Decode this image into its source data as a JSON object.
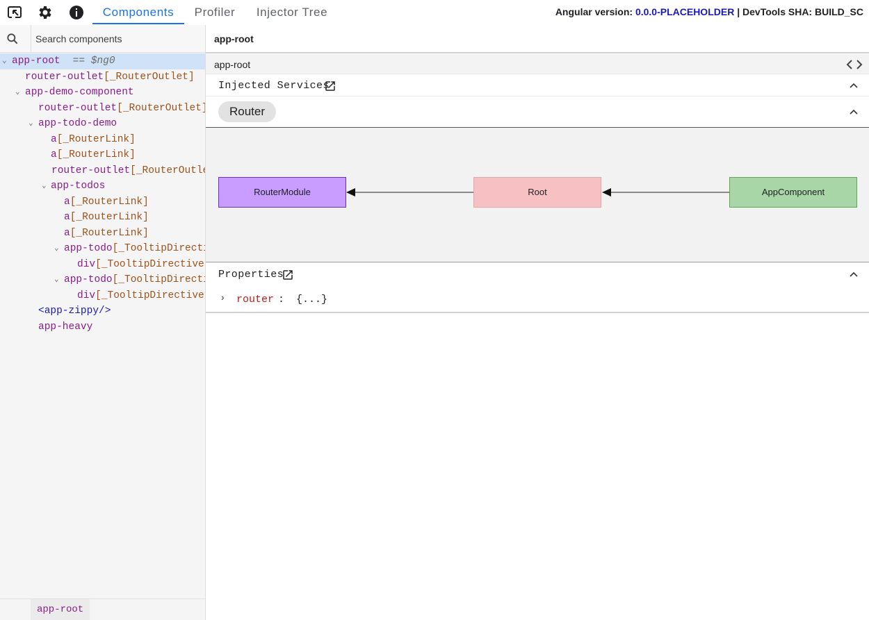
{
  "toolbar": {
    "icons": [
      "inspect-element-icon",
      "gear-icon",
      "info-icon"
    ],
    "tabs": [
      {
        "label": "Components",
        "active": true
      },
      {
        "label": "Profiler",
        "active": false
      },
      {
        "label": "Injector Tree",
        "active": false
      }
    ],
    "version_label": "Angular version:",
    "version_value": "0.0.0-PLACEHOLDER",
    "sha_text": "| DevTools SHA: BUILD_SC"
  },
  "search": {
    "placeholder": "Search components",
    "value": ""
  },
  "tree": {
    "nodes": [
      {
        "name": "app-root",
        "dir": "",
        "ng0": "== $ng0",
        "expanded": true,
        "selected": true
      },
      {
        "name": "router-outlet",
        "dir": "[_RouterOutlet]"
      },
      {
        "name": "app-demo-component",
        "dir": "",
        "expanded": true
      },
      {
        "name": "router-outlet",
        "dir": "[_RouterOutlet]"
      },
      {
        "name": "app-todo-demo",
        "dir": "",
        "expanded": true
      },
      {
        "name": "a",
        "dir": "[_RouterLink]"
      },
      {
        "name": "a",
        "dir": "[_RouterLink]"
      },
      {
        "name": "router-outlet",
        "dir": "[_RouterOutlet]"
      },
      {
        "name": "app-todos",
        "dir": "",
        "expanded": true
      },
      {
        "name": "a",
        "dir": "[_RouterLink]"
      },
      {
        "name": "a",
        "dir": "[_RouterLink]"
      },
      {
        "name": "a",
        "dir": "[_RouterLink]"
      },
      {
        "name": "app-todo",
        "dir": "[_TooltipDirective]",
        "expanded": true
      },
      {
        "name": "div",
        "dir": "[_TooltipDirective]"
      },
      {
        "name": "app-todo",
        "dir": "[_TooltipDirective]",
        "expanded": true
      },
      {
        "name": "div",
        "dir": "[_TooltipDirective]"
      },
      {
        "name": "<app-zippy/>",
        "dir": "",
        "zippy": true
      },
      {
        "name": "app-heavy",
        "dir": ""
      }
    ]
  },
  "breadcrumb": {
    "items": [
      "app-root"
    ]
  },
  "details": {
    "selected_title": "app-root",
    "selected_subtitle": "app-root",
    "injected_services_title": "Injected Services",
    "services": [
      "Router"
    ],
    "graph_nodes": [
      "RouterModule",
      "Root",
      "AppComponent"
    ],
    "properties_title": "Properties",
    "properties": [
      {
        "key": "router",
        "value": "{...}"
      }
    ]
  },
  "colors": {
    "accent": "#1a73e8",
    "component_name": "#8a1c8c",
    "directive_name": "#a0521a",
    "router_module_node": "#c99cff",
    "root_node": "#f7c0c2",
    "app_component_node": "#a9d6a7"
  }
}
